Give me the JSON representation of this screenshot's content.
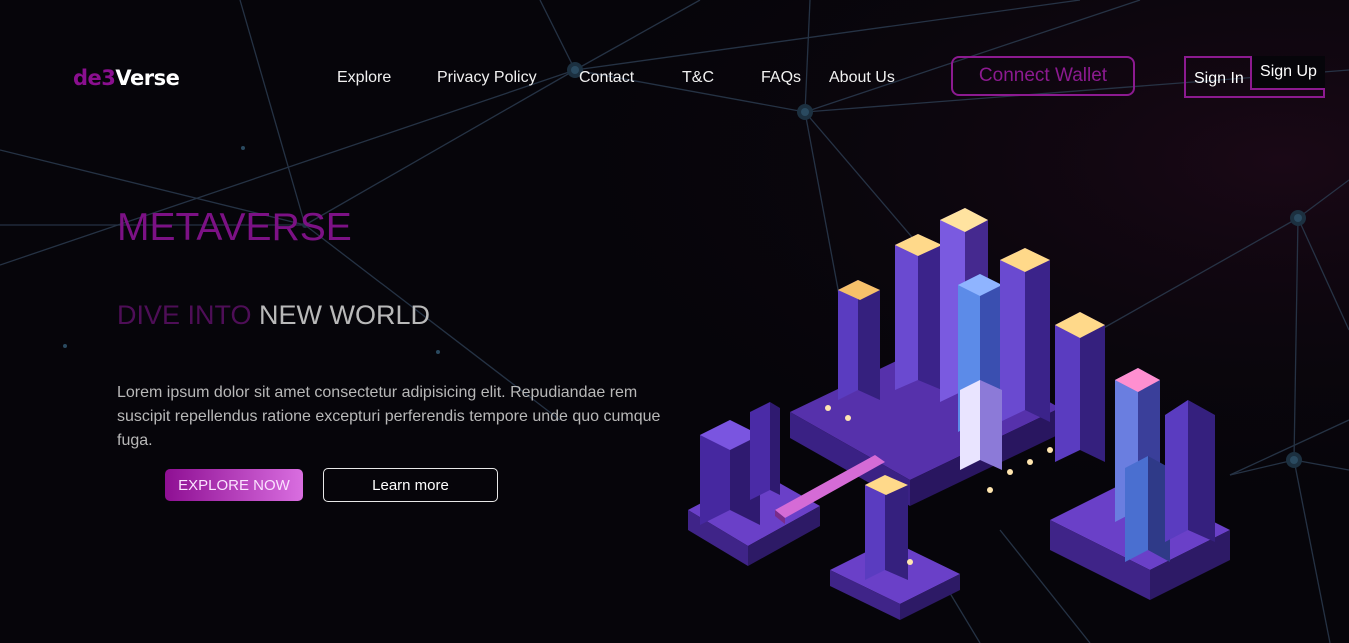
{
  "brand": {
    "prefix": "de3",
    "name": "Verse"
  },
  "nav": {
    "items": [
      {
        "label": "Explore"
      },
      {
        "label": "Privacy Policy"
      },
      {
        "label": "Contact"
      },
      {
        "label": "T&C"
      },
      {
        "label": "FAQs"
      },
      {
        "label": "About Us"
      }
    ]
  },
  "header": {
    "connect_wallet": "Connect Wallet",
    "sign_in": "Sign In",
    "sign_up": "Sign Up"
  },
  "hero": {
    "title": "METAVERSE",
    "subtitle_part1": "DIVE INTO",
    "subtitle_part2": "NEW WORLD",
    "paragraph": "Lorem ipsum dolor sit amet consectetur adipisicing elit. Repudiandae rem suscipit repellendus ratione excepturi perferendis tempore unde quo cumque fuga.",
    "explore_button": "EXPLORE NOW",
    "learn_button": "Learn more"
  },
  "colors": {
    "accent": "#8c1a90",
    "background": "#06050a",
    "city": "#5a2fb0"
  },
  "illustration": {
    "icon": "isometric-city-illustration"
  }
}
